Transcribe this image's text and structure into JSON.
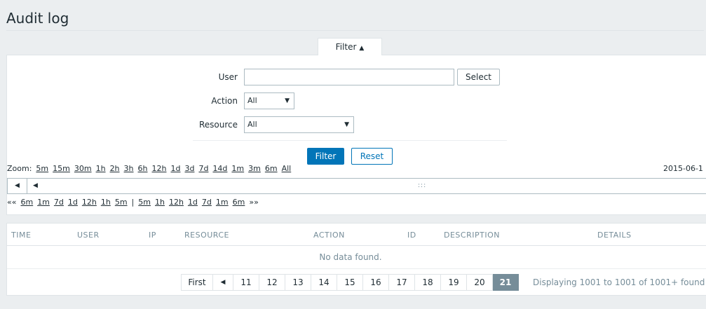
{
  "page": {
    "title": "Audit log"
  },
  "filter": {
    "tab_label": "Filter",
    "user_label": "User",
    "user_value": "",
    "select_button": "Select",
    "action_label": "Action",
    "action_value": "All",
    "resource_label": "Resource",
    "resource_value": "All",
    "filter_button": "Filter",
    "reset_button": "Reset"
  },
  "zoom": {
    "label": "Zoom:",
    "options": [
      "5m",
      "15m",
      "30m",
      "1h",
      "2h",
      "3h",
      "6h",
      "12h",
      "1d",
      "3d",
      "7d",
      "14d",
      "1m",
      "3m",
      "6m",
      "All"
    ],
    "date": "2015-06-1"
  },
  "navigation": {
    "back_symbol": "««",
    "back": [
      "6m",
      "1m",
      "7d",
      "1d",
      "12h",
      "1h",
      "5m"
    ],
    "separator": "|",
    "forward": [
      "5m",
      "1h",
      "12h",
      "1d",
      "7d",
      "1m",
      "6m"
    ],
    "forward_symbol": "»»"
  },
  "table": {
    "columns": [
      "TIME",
      "USER",
      "IP",
      "RESOURCE",
      "ACTION",
      "ID",
      "DESCRIPTION",
      "DETAILS"
    ],
    "empty_text": "No data found."
  },
  "pager": {
    "first": "First",
    "prev_icon": "prev-arrow-icon",
    "pages": [
      "11",
      "12",
      "13",
      "14",
      "15",
      "16",
      "17",
      "18",
      "19",
      "20",
      "21"
    ],
    "active": "21",
    "displaying": "Displaying 1001 to 1001 of 1001+ found"
  },
  "colors": {
    "primary": "#0275b8",
    "muted": "#768d99",
    "background": "#ebeef0"
  }
}
